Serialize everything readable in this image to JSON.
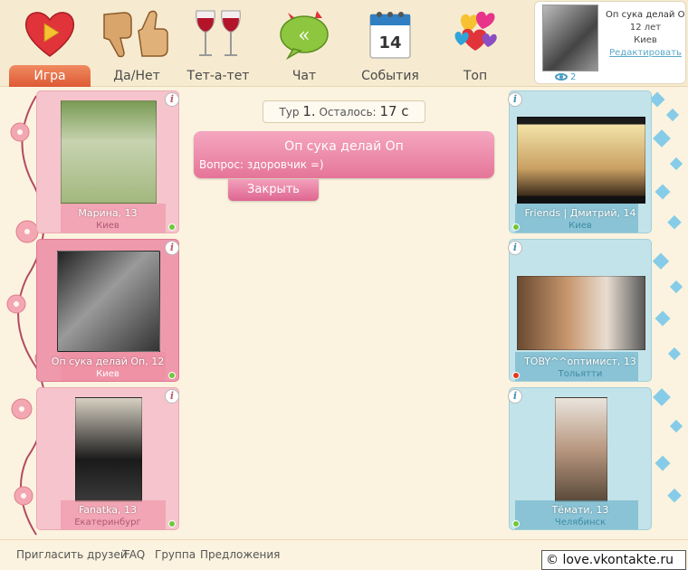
{
  "nav": {
    "items": [
      {
        "label": "Игра",
        "icon": "heart-play-icon",
        "active": true
      },
      {
        "label": "Да/Нет",
        "icon": "thumbs-icon"
      },
      {
        "label": "Тет-а-тет",
        "icon": "wine-glasses-icon"
      },
      {
        "label": "Чат",
        "icon": "chat-bubble-icon"
      },
      {
        "label": "События",
        "icon": "calendar-icon",
        "day": "14"
      },
      {
        "label": "Топ",
        "icon": "hearts-bouquet-icon"
      }
    ]
  },
  "profile": {
    "name": "Оп сука делай Оп",
    "age": "12 лет",
    "city": "Киев",
    "edit_label": "Редактировать",
    "views": "2"
  },
  "round": {
    "label": "Тур",
    "number": "1.",
    "remaining_label": "Осталось:",
    "remaining": "17 с"
  },
  "question": {
    "author": "Оп сука делай Оп",
    "text": "Вопрос: здоровчик =)",
    "close_label": "Закрыть"
  },
  "players": {
    "left": [
      {
        "name": "Марина, 13",
        "city": "Киев",
        "status": "online"
      },
      {
        "name": "Оп сука делай Оп, 12",
        "city": "Киев",
        "status": "online"
      },
      {
        "name": "Fanatka, 13",
        "city": "Екатеринбург",
        "status": "online"
      }
    ],
    "right": [
      {
        "name": "Friends | Дмитрий, 14",
        "city": "Киев",
        "status": "online"
      },
      {
        "name": "TOBY^^оптимист, 13",
        "city": "Тольятти",
        "status": "offline"
      },
      {
        "name": "Тёмати, 13",
        "city": "Челябинск",
        "status": "online"
      }
    ]
  },
  "footer": {
    "links": [
      "Пригласить друзей",
      "FAQ",
      "Группа",
      "Предложения"
    ]
  },
  "copyright": "© love.vkontakte.ru",
  "colors": {
    "accent_orange": "#dd5a35",
    "girl_card": "#f6c4cc",
    "boy_card": "#c3e3ea",
    "link_blue": "#5aa8c8",
    "online": "#6fc83b",
    "offline": "#e23b1d"
  }
}
